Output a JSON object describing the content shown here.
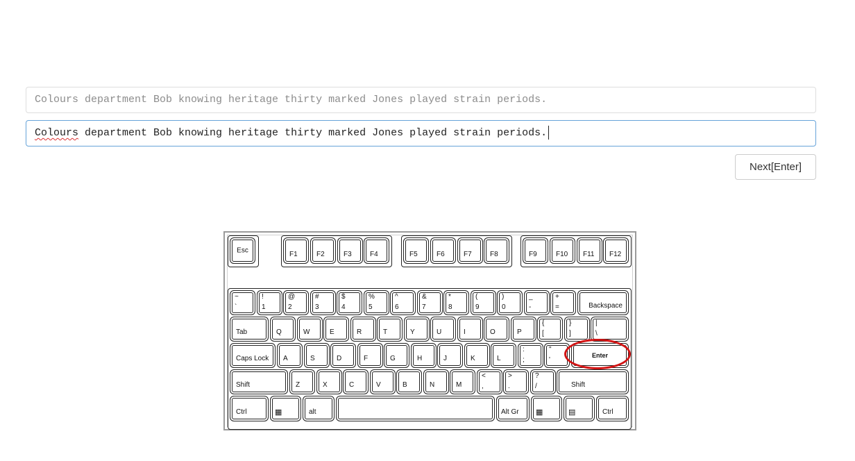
{
  "target_sentence": "Colours department Bob knowing heritage thirty marked Jones played strain periods.",
  "typed_first_word": "Colours",
  "typed_rest": " department Bob knowing heritage thirty marked Jones played strain periods.",
  "next_button_label": "Next[Enter]",
  "highlight_color": "#d31414",
  "keyboard": {
    "esc": "Esc",
    "f1": "F1",
    "f2": "F2",
    "f3": "F3",
    "f4": "F4",
    "f5": "F5",
    "f6": "F6",
    "f7": "F7",
    "f8": "F8",
    "f9": "F9",
    "f10": "F10",
    "f11": "F11",
    "f12": "F12",
    "num_row": [
      {
        "top": "~",
        "bottom": "`"
      },
      {
        "top": "!",
        "bottom": "1"
      },
      {
        "top": "@",
        "bottom": "2"
      },
      {
        "top": "#",
        "bottom": "3"
      },
      {
        "top": "$",
        "bottom": "4"
      },
      {
        "top": "%",
        "bottom": "5"
      },
      {
        "top": "^",
        "bottom": "6"
      },
      {
        "top": "&",
        "bottom": "7"
      },
      {
        "top": "*",
        "bottom": "8"
      },
      {
        "top": "(",
        "bottom": "9"
      },
      {
        "top": ")",
        "bottom": "0"
      },
      {
        "top": "_",
        "bottom": "-"
      },
      {
        "top": "+",
        "bottom": "="
      }
    ],
    "backspace": "Backspace",
    "tab": "Tab",
    "q_row": [
      "Q",
      "W",
      "E",
      "R",
      "T",
      "Y",
      "U",
      "I",
      "O",
      "P"
    ],
    "brace_open": {
      "top": "{",
      "bottom": "["
    },
    "brace_close": {
      "top": "}",
      "bottom": "]"
    },
    "pipe": {
      "top": "|",
      "bottom": "\\"
    },
    "caps_lock": "Caps Lock",
    "a_row": [
      "A",
      "S",
      "D",
      "F",
      "G",
      "H",
      "J",
      "K",
      "L"
    ],
    "semicolon": {
      "top": ":",
      "bottom": ";"
    },
    "quote": {
      "top": "\"",
      "bottom": "'"
    },
    "enter": "Enter",
    "shift_left": "Shift",
    "z_row": [
      "Z",
      "X",
      "C",
      "V",
      "B",
      "N",
      "M"
    ],
    "comma": {
      "top": "<",
      "bottom": ","
    },
    "period": {
      "top": ">",
      "bottom": "."
    },
    "slash": {
      "top": "?",
      "bottom": "/"
    },
    "shift_right": "Shift",
    "ctrl_left": "Ctrl",
    "alt": "alt",
    "alt_gr": "Alt Gr",
    "ctrl_right": "Ctrl",
    "win_icon": "windows-icon",
    "menu_icon": "context-menu-icon"
  }
}
